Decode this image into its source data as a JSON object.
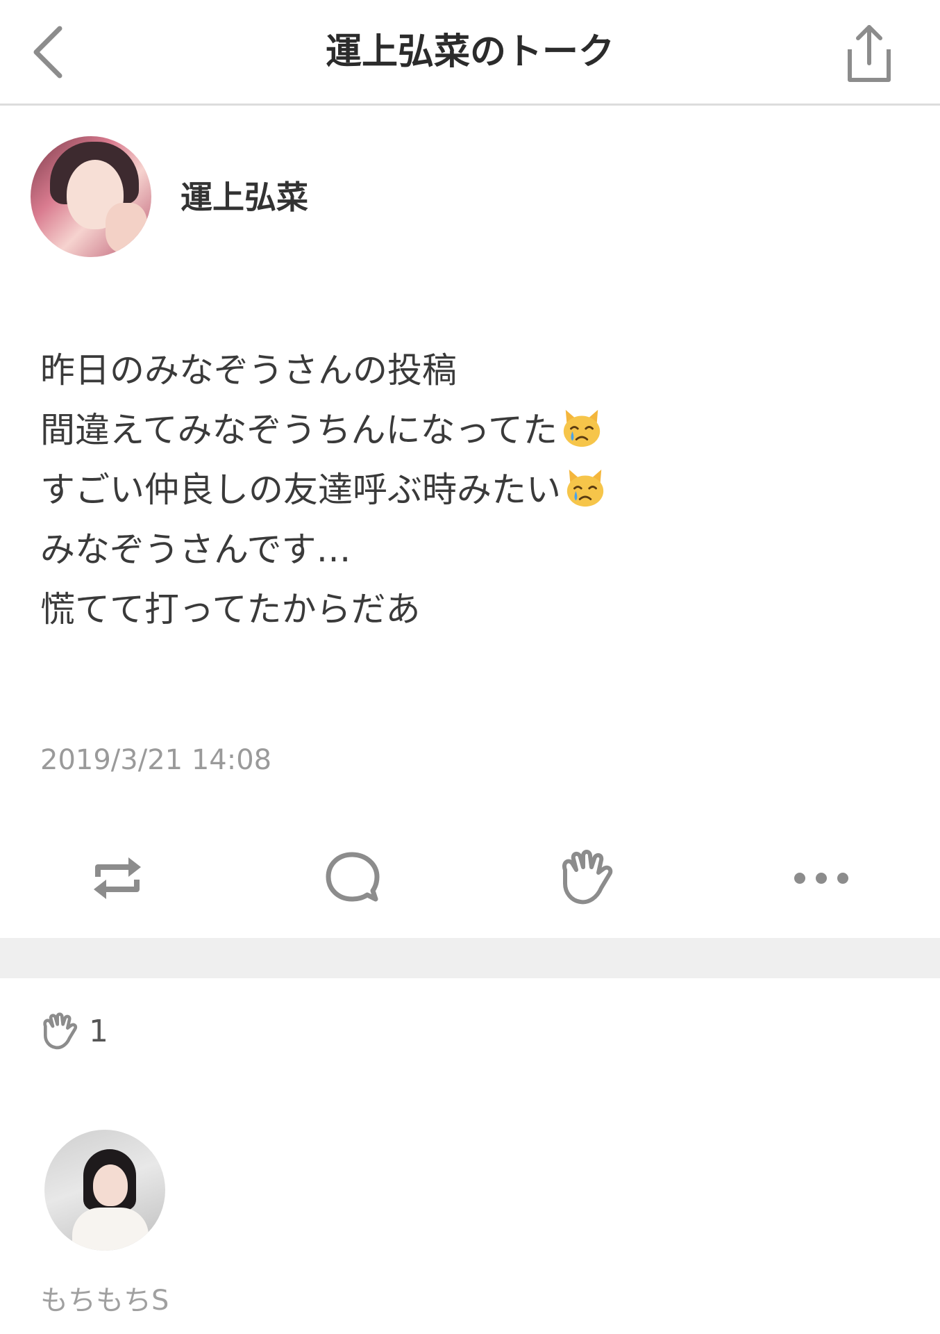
{
  "header": {
    "title": "運上弘菜のトーク",
    "back_icon": "chevron-left-icon",
    "share_icon": "share-icon"
  },
  "post": {
    "author_name": "運上弘菜",
    "lines": [
      {
        "text": "昨日のみなぞうさんの投稿",
        "emoji": ""
      },
      {
        "text": "間違えてみなぞうちんになってた",
        "emoji": "crying-cat-face"
      },
      {
        "text": "すごい仲良しの友達呼ぶ時みたい",
        "emoji": "crying-cat-face"
      },
      {
        "text": "みなぞうさんです…",
        "emoji": ""
      },
      {
        "text": "慌てて打ってたからだあ",
        "emoji": ""
      }
    ],
    "timestamp": "2019/3/21 14:08"
  },
  "actions": [
    {
      "name": "repost-icon"
    },
    {
      "name": "comment-icon"
    },
    {
      "name": "clap-icon"
    },
    {
      "name": "more-icon"
    }
  ],
  "reactions": {
    "count": "1",
    "icon": "clap-icon",
    "users": [
      {
        "name": "もちもちS"
      }
    ]
  },
  "colors": {
    "text": "#333333",
    "muted": "#9a9a9a",
    "icon": "#8c8c8c",
    "divider": "#efefef"
  }
}
